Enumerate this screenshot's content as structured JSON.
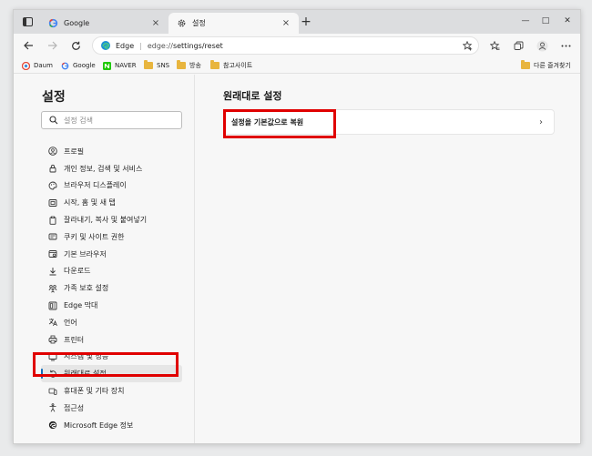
{
  "tabs": [
    {
      "title": "Google",
      "close": "×"
    },
    {
      "title": "설정",
      "close": "×"
    }
  ],
  "new_tab": "+",
  "window_controls": {
    "minimize": "—",
    "maximize": "□",
    "close": "✕"
  },
  "address": {
    "brand": "Edge",
    "separator": "|",
    "url_host": "edge://",
    "url_path": "settings/reset"
  },
  "bookmarks": [
    {
      "label": "Daum",
      "icon": "daum-icon"
    },
    {
      "label": "Google",
      "icon": "google-icon"
    },
    {
      "label": "NAVER",
      "icon": "naver-icon"
    },
    {
      "label": "SNS",
      "icon": "folder-icon"
    },
    {
      "label": "방송",
      "icon": "folder-icon"
    },
    {
      "label": "참고사이트",
      "icon": "folder-icon"
    }
  ],
  "other_favorites": "다른 즐겨찾기",
  "sidebar": {
    "title": "설정",
    "search_placeholder": "설정 검색",
    "items": [
      {
        "label": "프로필",
        "icon": "profile-icon"
      },
      {
        "label": "개인 정보, 검색 및 서비스",
        "icon": "lock-icon"
      },
      {
        "label": "브라우저 디스플레이",
        "icon": "palette-icon"
      },
      {
        "label": "시작, 홈 및 새 탭",
        "icon": "home-icon"
      },
      {
        "label": "잘라내기, 복사 및 붙여넣기",
        "icon": "clipboard-icon"
      },
      {
        "label": "쿠키 및 사이트 권한",
        "icon": "cookie-icon"
      },
      {
        "label": "기본 브라우저",
        "icon": "browser-icon"
      },
      {
        "label": "다운로드",
        "icon": "download-icon"
      },
      {
        "label": "가족 보호 설정",
        "icon": "family-icon"
      },
      {
        "label": "Edge 막대",
        "icon": "edge-bar-icon"
      },
      {
        "label": "언어",
        "icon": "language-icon"
      },
      {
        "label": "프린터",
        "icon": "printer-icon"
      },
      {
        "label": "시스템 및 성능",
        "icon": "system-icon"
      },
      {
        "label": "원래대로 설정",
        "icon": "reset-icon"
      },
      {
        "label": "휴대폰 및 기타 장치",
        "icon": "phone-icon"
      },
      {
        "label": "접근성",
        "icon": "accessibility-icon"
      },
      {
        "label": "Microsoft Edge 정보",
        "icon": "edge-logo-icon"
      }
    ],
    "active_index": 13
  },
  "main": {
    "title": "원래대로 설정",
    "reset_card_label": "설정을 기본값으로 복원",
    "chevron": "›"
  },
  "colors": {
    "accent": "#0f6cbd",
    "highlight": "#e00000"
  }
}
